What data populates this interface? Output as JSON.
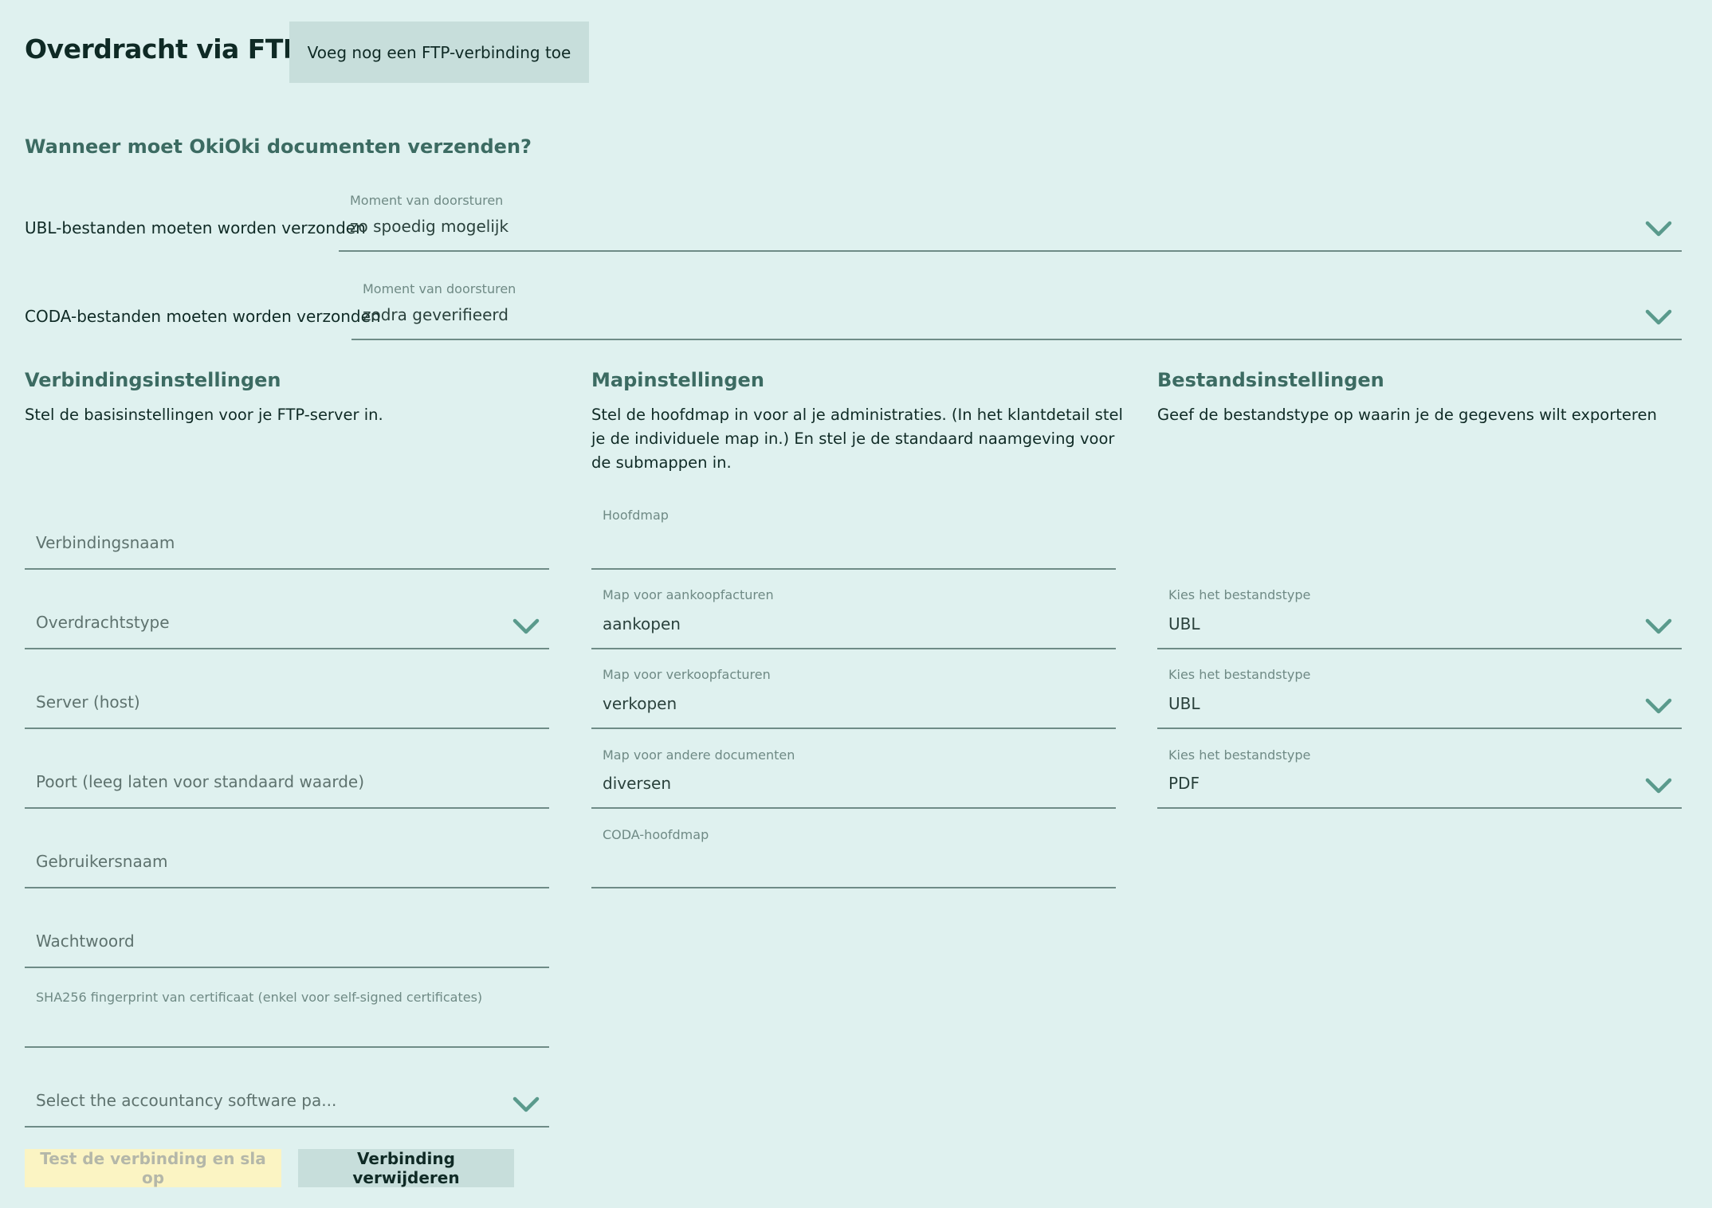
{
  "header": {
    "title": "Overdracht via FTP",
    "add_button": "Voeg nog een FTP-verbinding toe"
  },
  "when": {
    "heading": "Wanneer moet OkiOki documenten verzenden?",
    "ubl": {
      "label": "UBL-bestanden moeten worden verzonden",
      "field_label": "Moment van doorsturen",
      "value": "zo spoedig mogelijk"
    },
    "coda": {
      "label": "CODA-bestanden moeten worden verzonden",
      "field_label": "Moment van doorsturen",
      "value": "zodra geverifieerd"
    }
  },
  "connection": {
    "title": "Verbindingsinstellingen",
    "description": "Stel de basisinstellingen voor je FTP-server in.",
    "name_placeholder": "Verbindingsnaam",
    "type_placeholder": "Overdrachtstype",
    "host_placeholder": "Server (host)",
    "port_placeholder": "Poort (leeg laten voor standaard waarde)",
    "user_placeholder": "Gebruikersnaam",
    "password_placeholder": "Wachtwoord",
    "fingerprint_label": "SHA256 fingerprint van certificaat (enkel voor self-signed certificates)",
    "software_placeholder": "Select the accountancy software pa..."
  },
  "folders": {
    "title": "Mapinstellingen",
    "description": "Stel de hoofdmap in voor al je administraties. (In het klantdetail stel je de individuele map in.) En stel je de standaard naamgeving voor de submappen in.",
    "root_label": "Hoofdmap",
    "purchase_label": "Map voor aankoopfacturen",
    "purchase_value": "aankopen",
    "sales_label": "Map voor verkoopfacturen",
    "sales_value": "verkopen",
    "other_label": "Map voor andere documenten",
    "other_value": "diversen",
    "coda_label": "CODA-hoofdmap"
  },
  "files": {
    "title": "Bestandsinstellingen",
    "description": "Geef de bestandstype op waarin je de gegevens wilt exporteren",
    "type1_label": "Kies het bestandstype",
    "type1_value": "UBL",
    "type2_label": "Kies het bestandstype",
    "type2_value": "UBL",
    "type3_label": "Kies het bestandstype",
    "type3_value": "PDF"
  },
  "actions": {
    "test": "Test de verbinding en sla op",
    "delete": "Verbinding verwijderen"
  },
  "colors": {
    "background": "#dff1ef",
    "accent": "#5a9a8c",
    "test_button": "#fbf4c3",
    "secondary_button": "#c7dedb"
  },
  "icons": {
    "dropdown": "chevron-down-icon"
  }
}
